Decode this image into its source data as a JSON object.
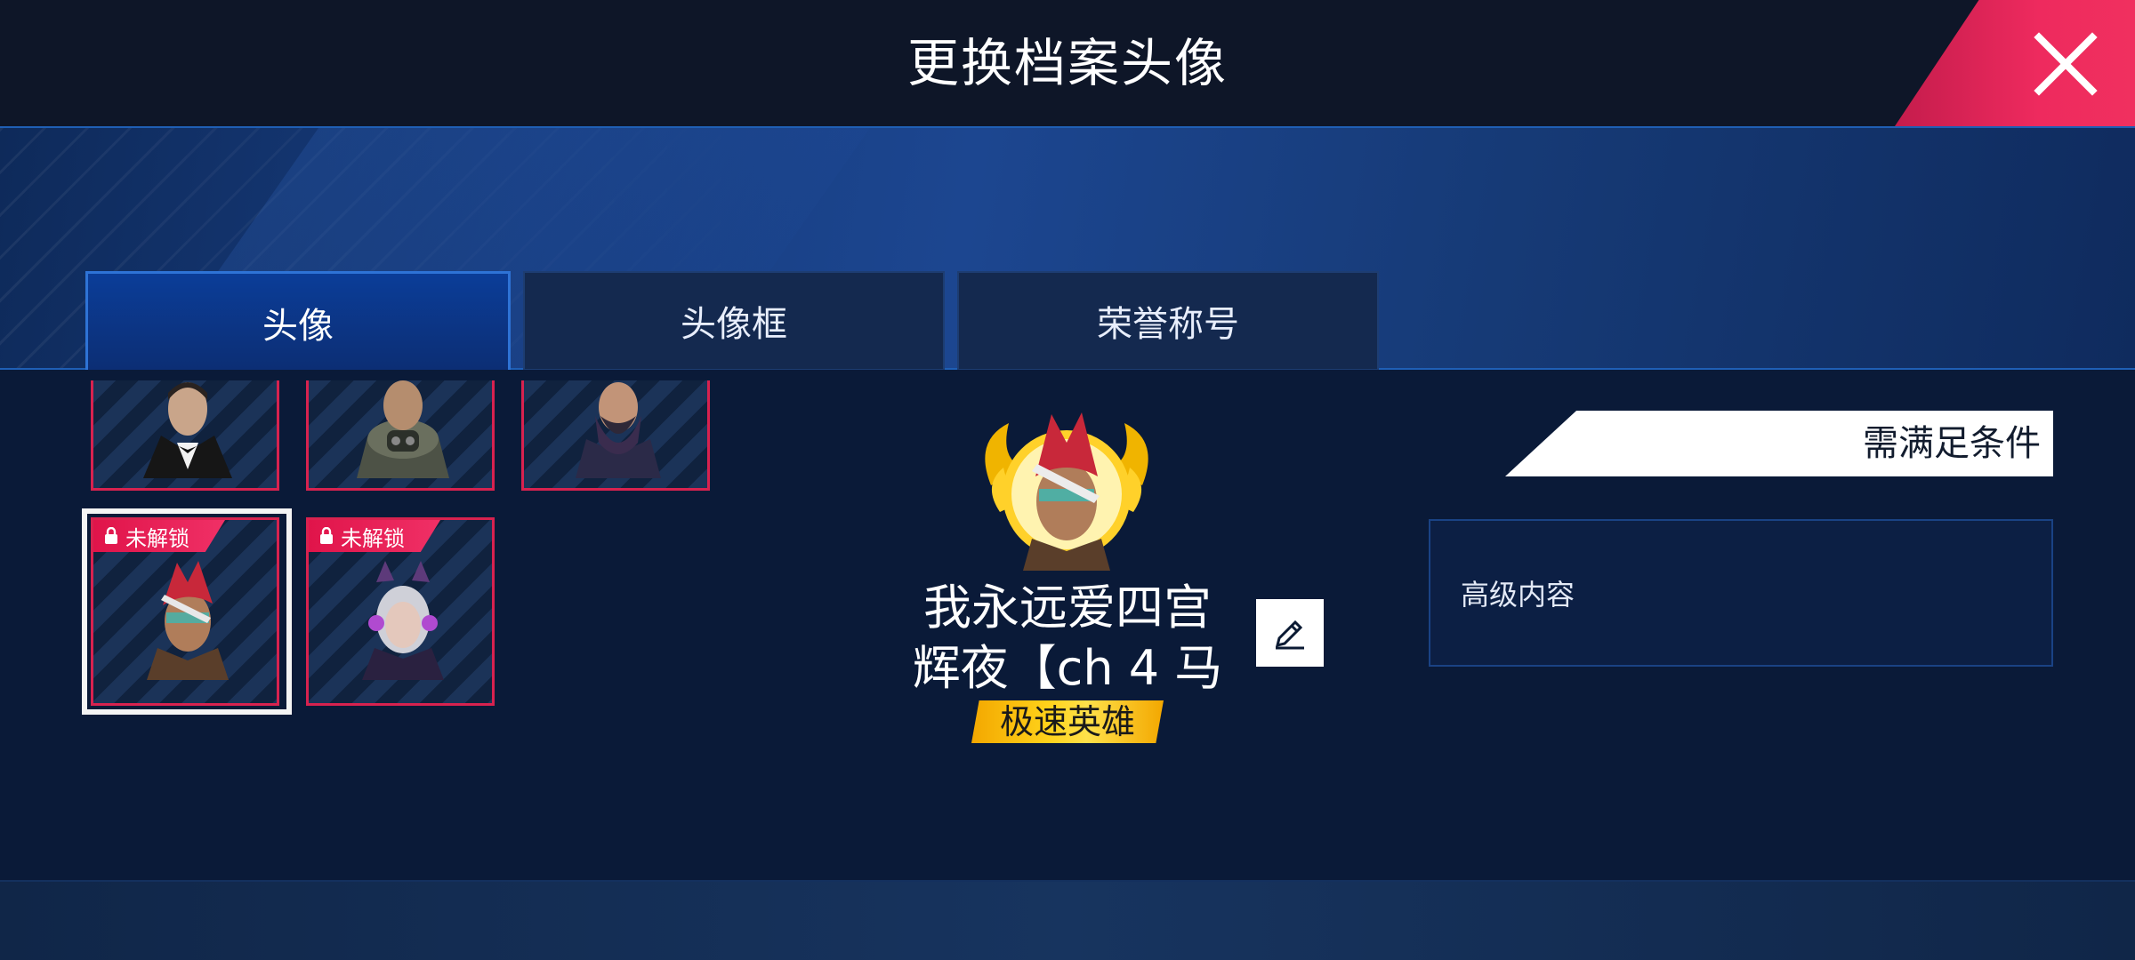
{
  "header": {
    "title": "更换档案头像",
    "close_icon": "close-icon"
  },
  "tabs": [
    {
      "label": "头像",
      "active": true
    },
    {
      "label": "头像框",
      "active": false
    },
    {
      "label": "荣誉称号",
      "active": false
    }
  ],
  "avatar_grid": {
    "row1": [
      {
        "name": "tuxedo-character"
      },
      {
        "name": "armored-character"
      },
      {
        "name": "bearded-character"
      }
    ],
    "row2": [
      {
        "name": "warrior-character",
        "lock_label": "未解锁",
        "selected": true
      },
      {
        "name": "cat-ear-character",
        "lock_label": "未解锁",
        "selected": false
      }
    ]
  },
  "profile": {
    "name_line1": "我永远爱四宫",
    "name_line2": "辉夜【ch 4 马",
    "honor_title": "极速英雄",
    "edit_icon": "pencil-icon"
  },
  "requirements": {
    "tag": "需满足条件",
    "content": "高级内容"
  },
  "colors": {
    "accent_red": "#ee2a5e",
    "tab_active": "#0b3d98",
    "badge_gold": "#ffd21a"
  }
}
